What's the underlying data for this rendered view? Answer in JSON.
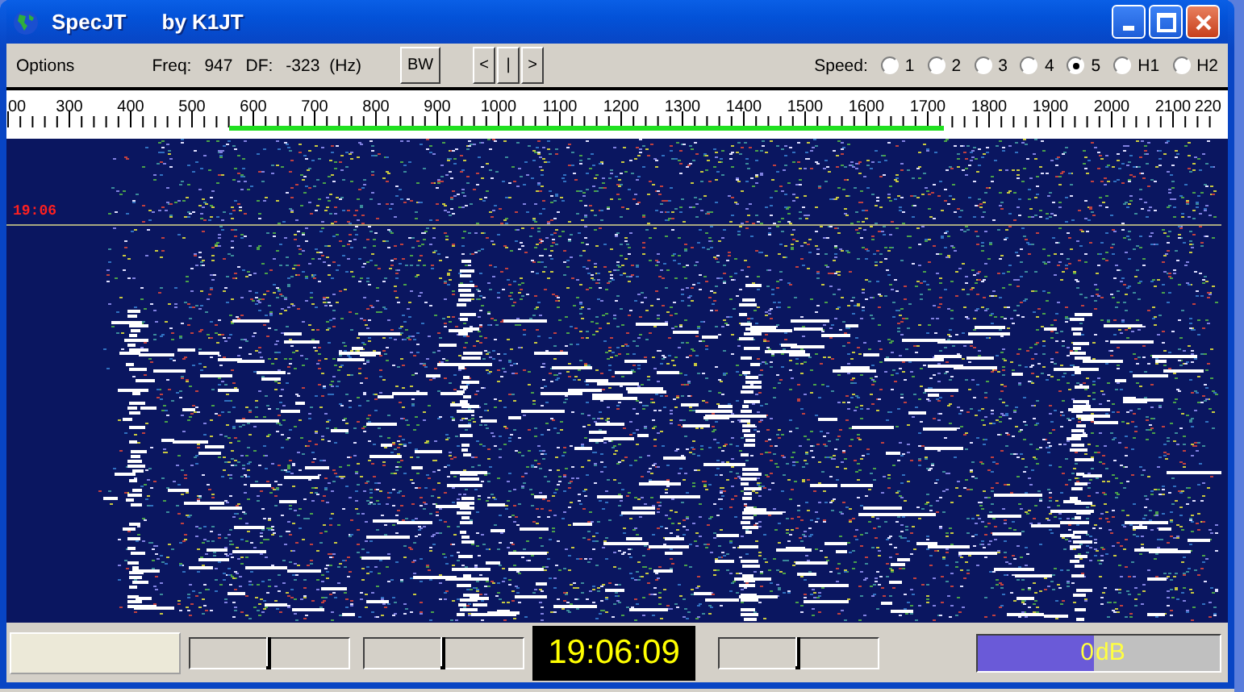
{
  "window": {
    "title": "SpecJT",
    "subtitle": "by K1JT"
  },
  "toolbar": {
    "menu": "Options",
    "freq_label": "Freq:",
    "freq": "947",
    "df_label": "DF:",
    "df": "-323",
    "df_unit": "(Hz)",
    "bw_button": "BW",
    "nav_buttons": [
      "<",
      "|",
      ">"
    ],
    "speed_label": "Speed:",
    "speeds": [
      {
        "label": "1",
        "selected": false
      },
      {
        "label": "2",
        "selected": false
      },
      {
        "label": "3",
        "selected": false
      },
      {
        "label": "4",
        "selected": false
      },
      {
        "label": "5",
        "selected": true
      },
      {
        "label": "H1",
        "selected": false
      },
      {
        "label": "H2",
        "selected": false
      }
    ]
  },
  "ruler": {
    "labels": [
      "00",
      "300",
      "400",
      "500",
      "600",
      "700",
      "800",
      "900",
      "1000",
      "1100",
      "1200",
      "1300",
      "1400",
      "1500",
      "1600",
      "1700",
      "1800",
      "1900",
      "2000",
      "2100",
      "220"
    ]
  },
  "waterfall": {
    "time_mark": "19:06"
  },
  "status_bar": {
    "sliders": [
      {
        "level": 0.5
      },
      {
        "level": 0.5
      },
      {
        "level": 0.5
      }
    ],
    "clock": "19:06:09",
    "meter": {
      "level": 0.48,
      "value": "0",
      "unit": "dB"
    }
  }
}
